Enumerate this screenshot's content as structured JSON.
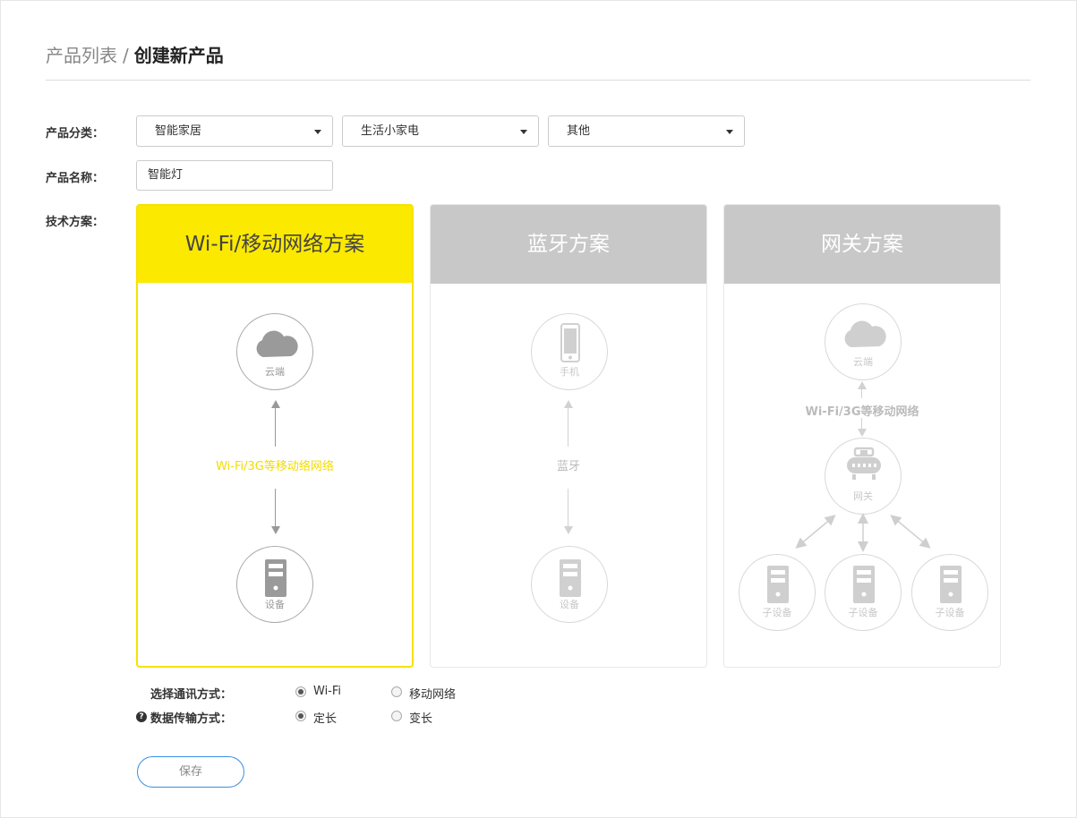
{
  "breadcrumb": {
    "parent": "产品列表",
    "separator": "/",
    "current": "创建新产品"
  },
  "form": {
    "category_label": "产品分类：",
    "category_1": "智能家居",
    "category_2": "生活小家电",
    "category_3": "其他",
    "name_label": "产品名称：",
    "name_value": "智能灯",
    "tech_label": "技术方案："
  },
  "cards": {
    "wifi": {
      "title": "Wi-Fi/移动网络方案",
      "cloud": "云端",
      "link": "Wi-Fi/3G等移动络网络",
      "device": "设备"
    },
    "bt": {
      "title": "蓝牙方案",
      "phone": "手机",
      "link": "蓝牙",
      "device": "设备"
    },
    "gw": {
      "title": "网关方案",
      "cloud": "云端",
      "link": "Wi-Fi/3G等移动网络",
      "gateway": "网关",
      "sub1": "子设备",
      "sub2": "子设备",
      "sub3": "子设备"
    }
  },
  "options": {
    "comm_label": "选择通讯方式：",
    "comm_opt1": "Wi-Fi",
    "comm_opt2": "移动网络",
    "data_label": "数据传输方式：",
    "data_opt1": "定长",
    "data_opt2": "变长"
  },
  "save_label": "保存",
  "colors": {
    "accent": "#fbe900",
    "inactive_header": "#c8c8c8",
    "button_border": "#3a8ee6"
  }
}
